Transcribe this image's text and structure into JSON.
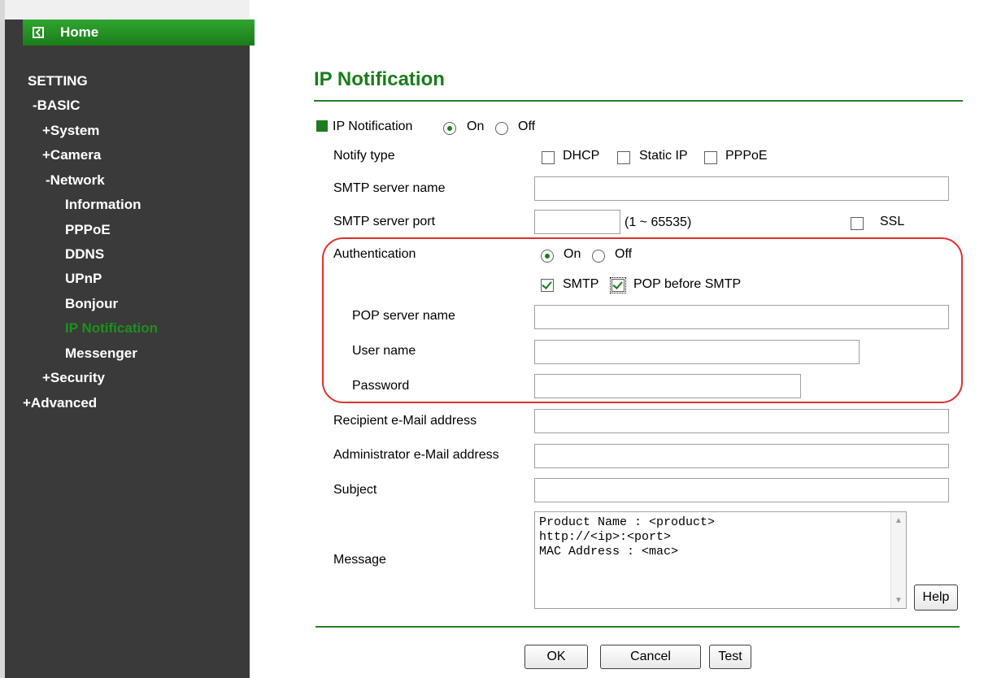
{
  "sidebar": {
    "home_label": "Home",
    "setting": "SETTING",
    "basic": "-BASIC",
    "system": "+System",
    "camera": "+Camera",
    "network": "-Network",
    "network_items": [
      "Information",
      "PPPoE",
      "DDNS",
      "UPnP",
      "Bonjour",
      "IP Notification",
      "Messenger"
    ],
    "security": "+Security",
    "advanced": "+Advanced",
    "active_item": "IP Notification"
  },
  "main": {
    "title": "IP Notification",
    "ip_notification": {
      "label": "IP Notification",
      "on": "On",
      "off": "Off",
      "selected": "On"
    },
    "notify_type": {
      "label": "Notify type",
      "dhcp": "DHCP",
      "static_ip": "Static IP",
      "pppoe": "PPPoE"
    },
    "smtp_server_name": {
      "label": "SMTP server name",
      "value": ""
    },
    "smtp_server_port": {
      "label": "SMTP server port",
      "value": "",
      "range": "(1 ~ 65535)",
      "ssl": "SSL"
    },
    "authentication": {
      "label": "Authentication",
      "on": "On",
      "off": "Off",
      "selected": "On",
      "smtp": "SMTP",
      "pop_before_smtp": "POP before SMTP"
    },
    "pop_server_name": {
      "label": "POP server name",
      "value": ""
    },
    "user_name": {
      "label": "User name",
      "value": ""
    },
    "password": {
      "label": "Password",
      "value": ""
    },
    "recipient": {
      "label": "Recipient e-Mail address",
      "value": ""
    },
    "administrator": {
      "label": "Administrator e-Mail address",
      "value": ""
    },
    "subject": {
      "label": "Subject",
      "value": ""
    },
    "message": {
      "label": "Message",
      "value": "Product Name : <product>\nhttp://<ip>:<port>\nMAC Address : <mac>"
    },
    "buttons": {
      "help": "Help",
      "ok": "OK",
      "cancel": "Cancel",
      "test": "Test"
    }
  },
  "colors": {
    "accent": "#1a7d1a",
    "sidebar_bg": "#3a3a3a",
    "highlight_outline": "#e03030"
  }
}
